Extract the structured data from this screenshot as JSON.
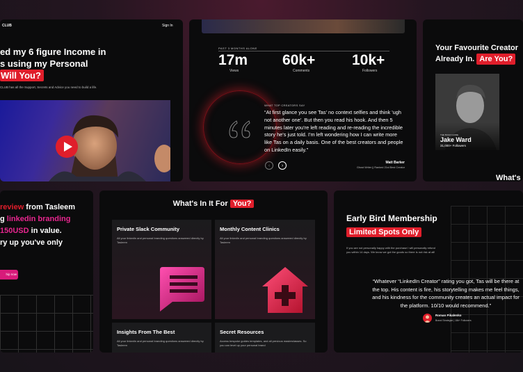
{
  "card1": {
    "brand": "CLUB",
    "signin": "Sign In",
    "headline_1": "ed my 6 figure Income in",
    "headline_2": "s using my Personal",
    "headline_tag": "Will You?",
    "subtext": "CLUB has all the Support, Secrets and Advice you need to build a life."
  },
  "card2": {
    "stats_heading": "PAST 3 MONTHS ALONE",
    "stats": [
      {
        "value": "17m",
        "label": "Views"
      },
      {
        "value": "60k+",
        "label": "Comments"
      },
      {
        "value": "10k+",
        "label": "Followers"
      }
    ],
    "testimonial_label": "WHAT TOP CREATORS SAY",
    "quote": "“At first glance you see Tas' no context selfies and think 'ugh not another one'. But then you read his hook. And then 5 minutes later you're left reading and re-reading the incredible story he's just told. I'm left wondering how I can write more like Tas on a daily basis. One of the best creators and people on LinkedIn easily.”",
    "author_name": "Matt Barker",
    "author_role": "Ghost Writer || Ranked 21st Best Creator",
    "prev_symbol": "‹",
    "next_symbol": "›"
  },
  "card3": {
    "heading_1": "Your Favourite Creator",
    "heading_2": "Already In.",
    "heading_tag": "Are You?",
    "profile_tag": "THE BUILD GUIDE",
    "profile_name": "Jake Ward",
    "profile_followers": "31,000+ Followers",
    "footer_text": "What's"
  },
  "card4": {
    "line1_red": "review",
    "line1_rest": " from Tasleem",
    "line2_start": "g ",
    "line2_pink": "linkedin branding",
    "line3_pink": "150USD",
    "line3_rest": " in value.",
    "line4": "ry up you've only",
    "button": "hip now"
  },
  "card5": {
    "title": "What's In It For",
    "title_tag": "You?",
    "features": [
      {
        "title": "Private Slack Community",
        "desc": "All your linkedin and personal branding questions answered directly by Tasleem"
      },
      {
        "title": "Monthly Content Clinics",
        "desc": "All your linkedin and personal branding questions answered directly by Tasleem"
      },
      {
        "title": "Insights From The Best",
        "desc": "All your linkedin and personal branding questions answered directly by Tasleem"
      },
      {
        "title": "Secret Resources",
        "desc": "Access bespoke guides templates, and all previous masterclasses. So you can level up your personal brand"
      }
    ]
  },
  "card6": {
    "title": "Early Bird Membership",
    "title_tag": "Limited Spots Only",
    "desc": "If you are not personally happy with the purchase I will personally refund you within 14 days. We know we got the goods so there is not risk at all!",
    "quote": "“Whatever “LinkedIn Creator” rating you got, Tas will be there at the top. His content is fire, his storytelling makes me feel things, and his kindness for the community creates an actual impact for the platform. 10/10 would recommend.”",
    "author_name": "Roman Pikalenko",
    "author_role": "Brand Strategist  |  18k+ Followers"
  },
  "colors": {
    "accent": "#e01e2b",
    "pink": "#e8268f",
    "bg": "#0b0b0c"
  }
}
